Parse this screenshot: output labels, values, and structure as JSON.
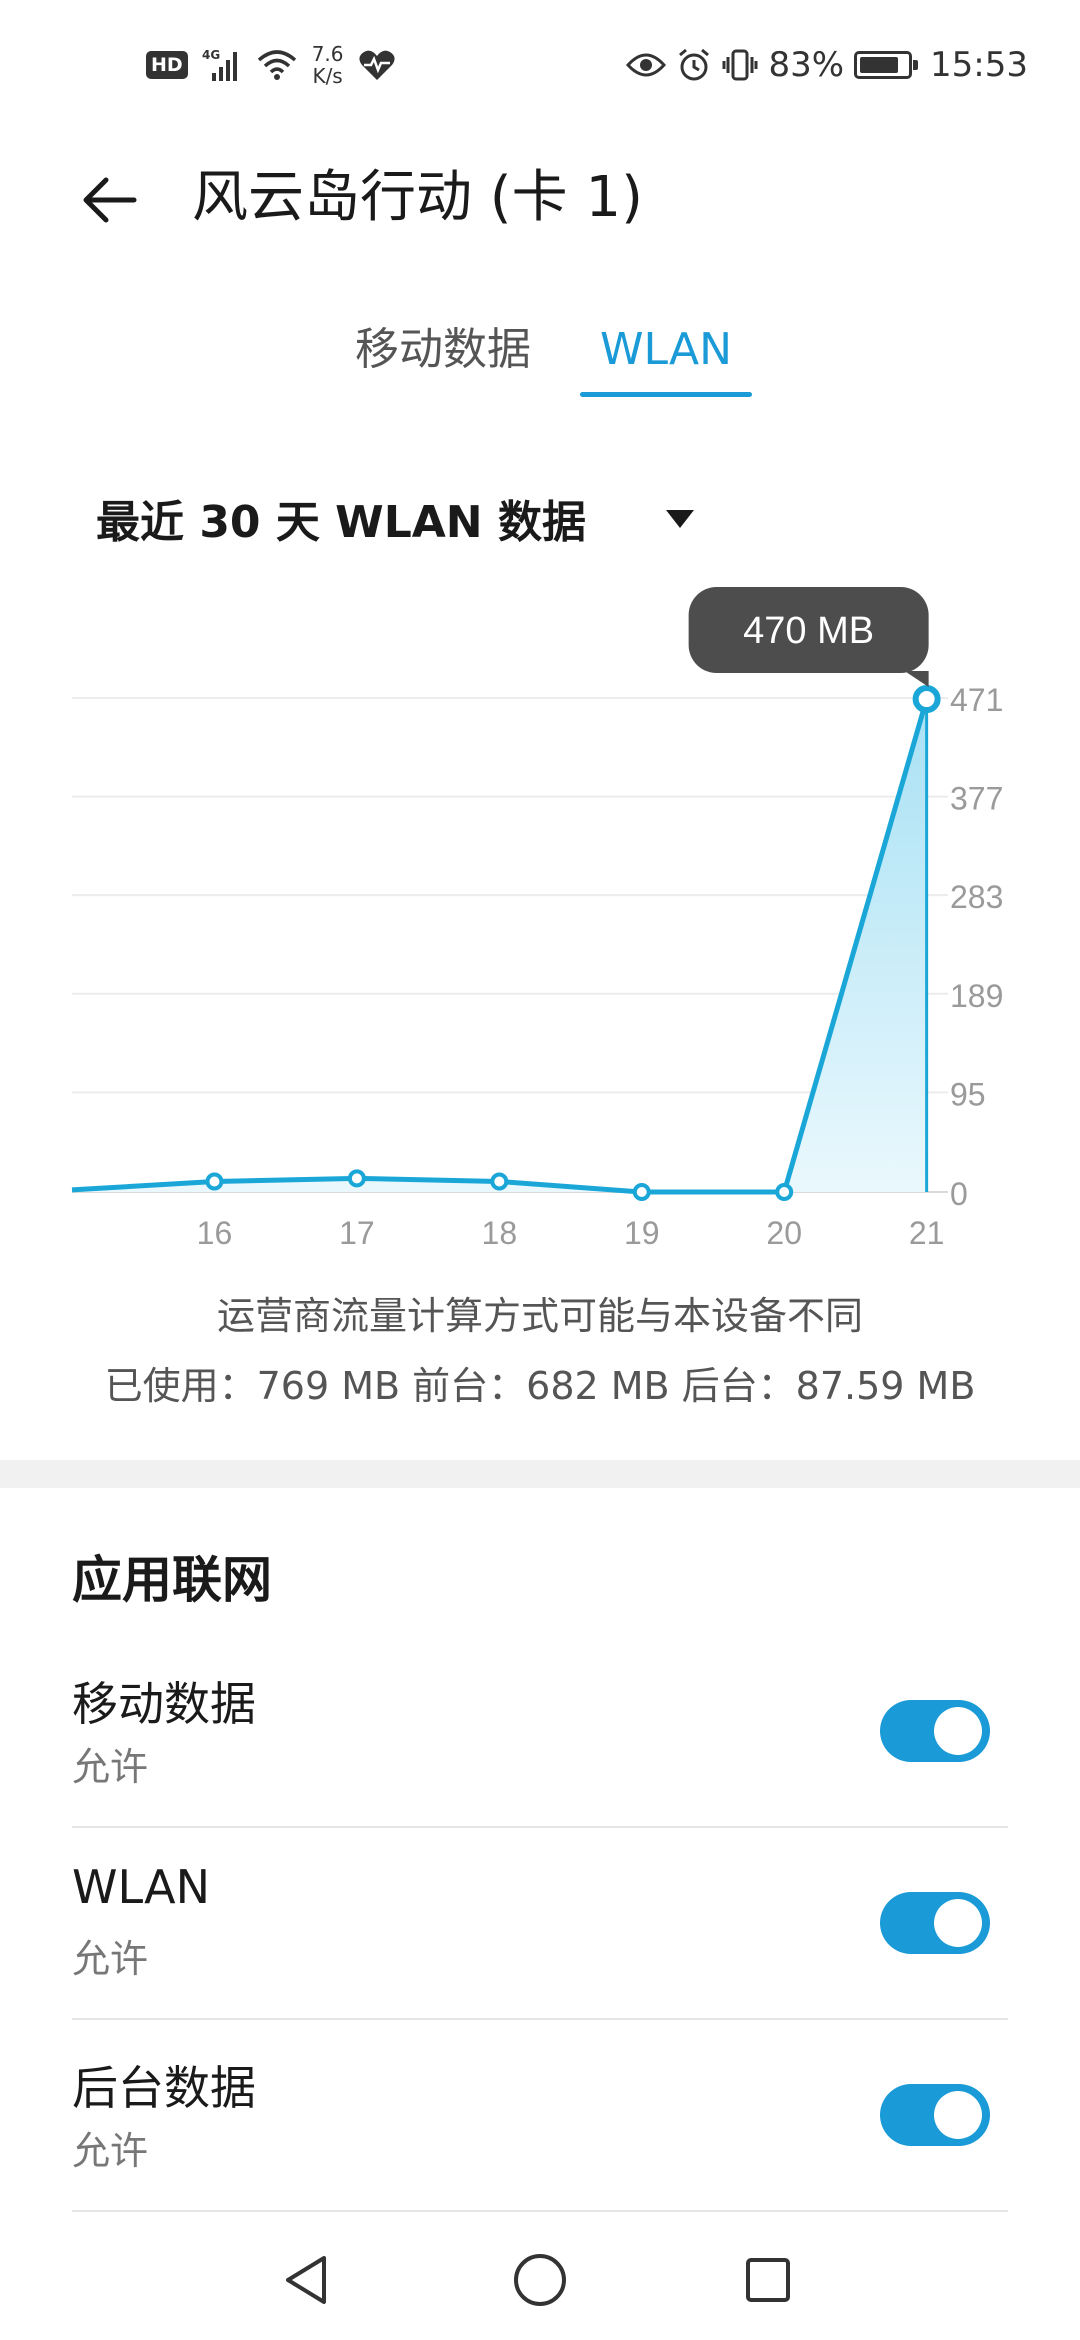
{
  "status_bar": {
    "hd": "HD",
    "network_type": "4G",
    "speed_value": "7.6",
    "speed_unit": "K/s",
    "battery_percent": "83%",
    "battery_level": 0.83,
    "time": "15:53",
    "icons": [
      "4g-signal-icon",
      "wifi-icon",
      "heart-rate-icon",
      "eye-icon",
      "alarm-icon",
      "vibrate-icon",
      "battery-icon"
    ]
  },
  "header": {
    "title": "风云岛行动 (卡 1)"
  },
  "tabs": [
    {
      "label": "移动数据",
      "active": false
    },
    {
      "label": "WLAN",
      "active": true
    }
  ],
  "period": {
    "label": "最近 30 天 WLAN 数据"
  },
  "tooltip": {
    "text": "470 MB"
  },
  "chart_data": {
    "type": "area",
    "x": [
      15,
      16,
      17,
      18,
      19,
      20,
      21
    ],
    "x_tick_labels": [
      "16",
      "17",
      "18",
      "19",
      "20",
      "21"
    ],
    "values": [
      2,
      10,
      13,
      10,
      0,
      0,
      470
    ],
    "y_tick_labels": [
      "471",
      "377",
      "283",
      "189",
      "95",
      "0"
    ],
    "ylim": [
      0,
      471
    ],
    "xlim": [
      15,
      21.15
    ],
    "grid": true,
    "colors": {
      "line": "#1aa7d8",
      "fill_top": "#a8e1f4",
      "fill_bottom": "#eaf8fd"
    }
  },
  "notes": {
    "carrier": "运营商流量计算方式可能与本设备不同",
    "usage": "已使用：769 MB 前台：682 MB 后台：87.59 MB"
  },
  "section": {
    "title": "应用联网"
  },
  "settings": [
    {
      "title": "移动数据",
      "subtitle": "允许",
      "enabled": true
    },
    {
      "title": "WLAN",
      "subtitle": "允许",
      "enabled": true
    },
    {
      "title": "后台数据",
      "subtitle": "允许",
      "enabled": true
    }
  ],
  "accent_color": "#1a9ad6"
}
